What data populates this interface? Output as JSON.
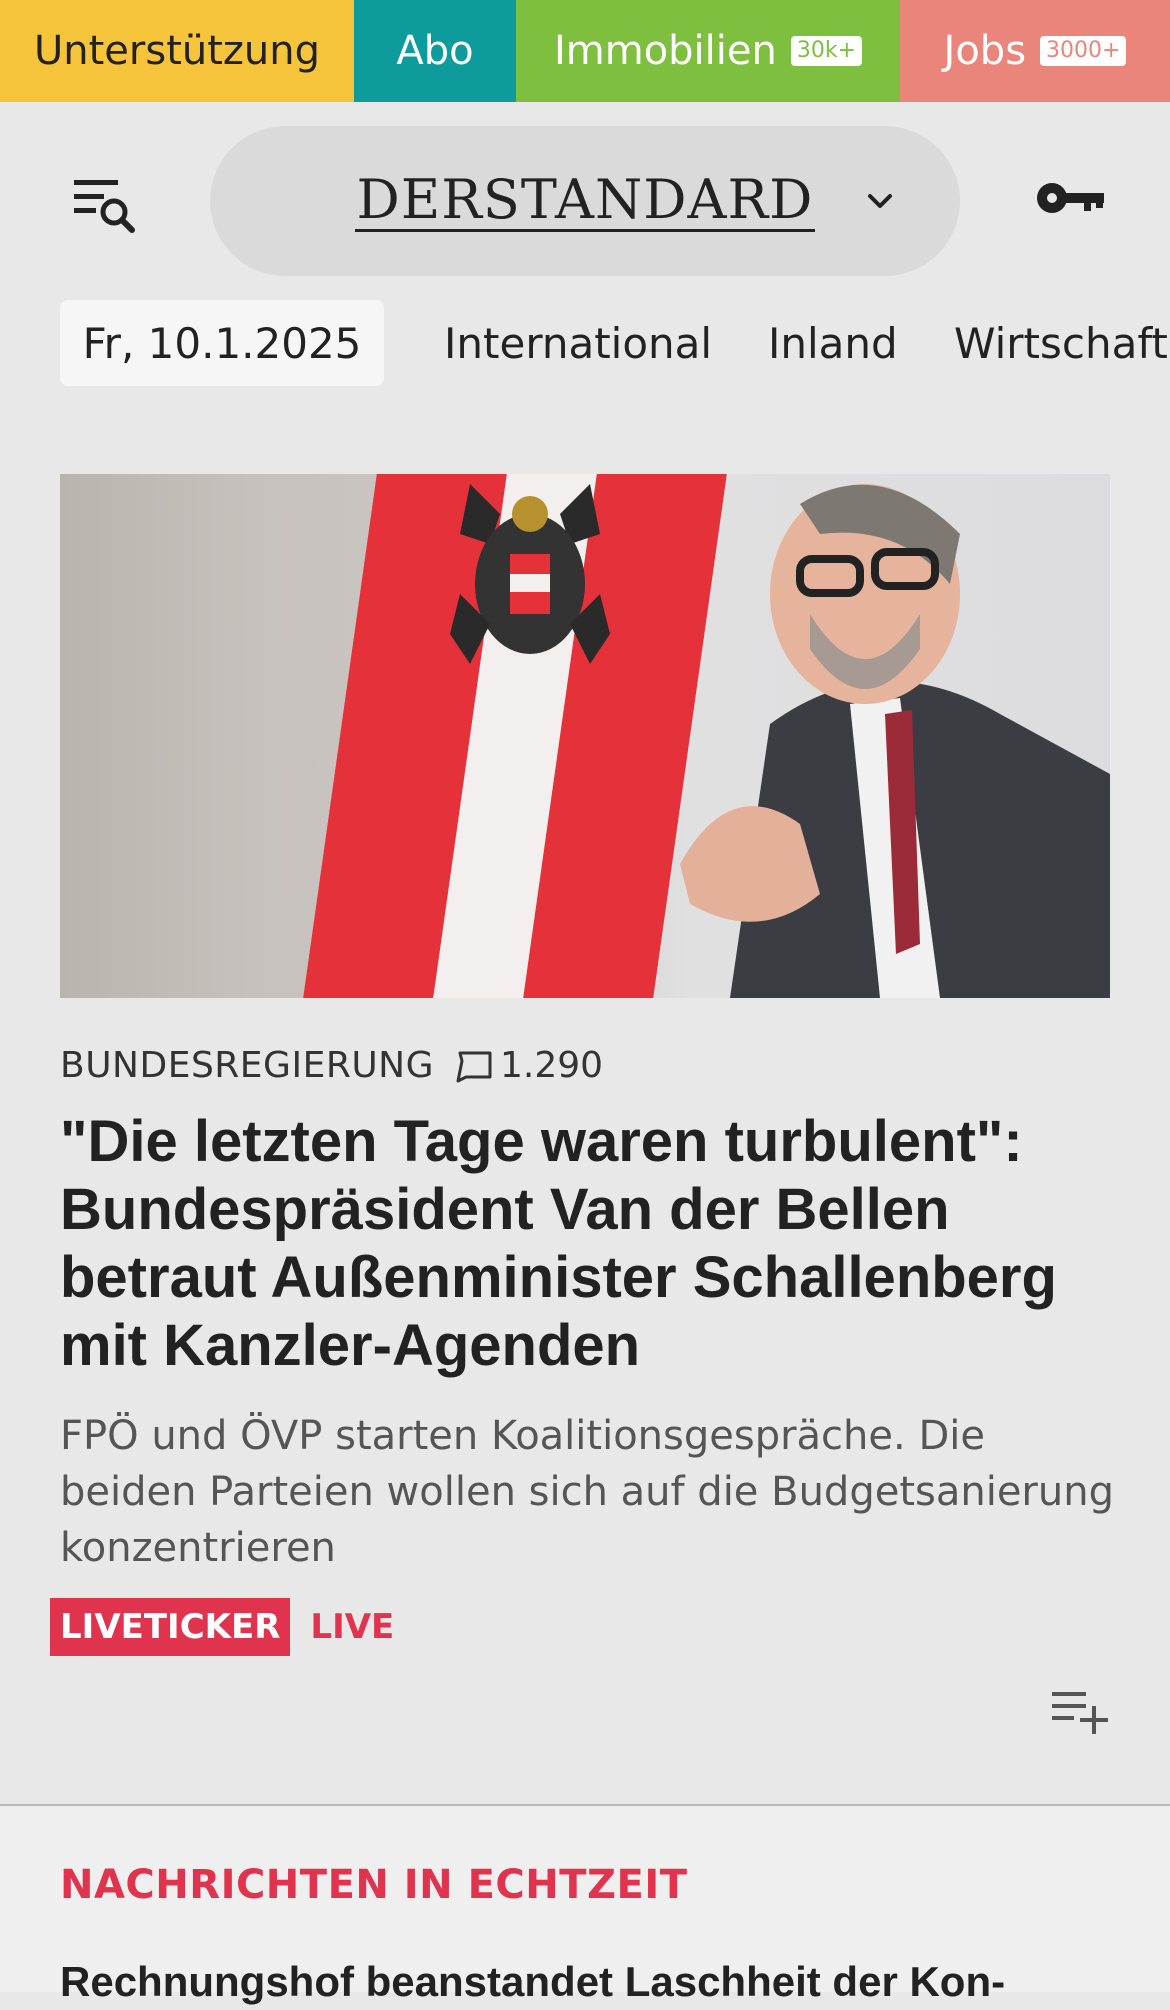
{
  "topnav": {
    "support": "Unterstützung",
    "abo": "Abo",
    "immobilien": "Immobilien",
    "immobilien_badge": "30k+",
    "jobs": "Jobs",
    "jobs_badge": "3000+"
  },
  "header": {
    "logo": "DERSTANDARD"
  },
  "tabs": {
    "date": "Fr, 10.1.2025",
    "items": [
      "International",
      "Inland",
      "Wirtschaft"
    ]
  },
  "article": {
    "kicker": "BUNDESREGIERUNG",
    "comments": "1.290",
    "headline": "\"Die letzten Tage waren turbulent\": Bundespräsident Van der Bellen betraut Außenminister Schallenberg mit Kanzler-Agenden",
    "teaser": "FPÖ und ÖVP starten Koalitionsgespräche. Die beiden Parteien wollen sich auf die Budgetsanierung konzentrieren",
    "live_badge": "LIVETICKER",
    "live_text": "LIVE"
  },
  "news": {
    "section_title": "NACHRICHTEN IN ECHTZEIT",
    "next_headline": "Rechnungshof beanstandet Laschheit der Kon-"
  },
  "icons": {
    "menu": "menu-search-icon",
    "chevron": "chevron-down-icon",
    "login": "key-icon",
    "comments": "comment-icon",
    "add_to_list": "playlist-add-icon"
  },
  "colors": {
    "support": "#f6c43b",
    "abo": "#0e9b9b",
    "immobilien": "#7fbf3f",
    "jobs": "#e9857b",
    "accent_live": "#e0344e"
  }
}
